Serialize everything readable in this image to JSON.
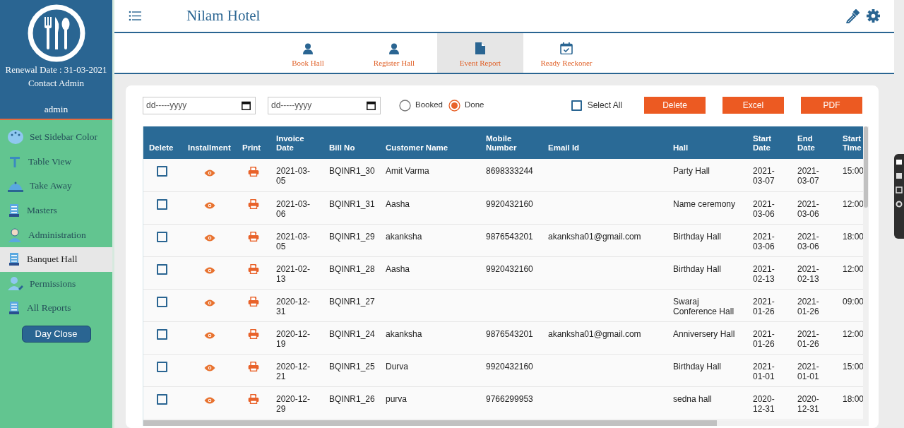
{
  "sidebar": {
    "renewal": "Renewal Date : 31-03-2021",
    "contact": "Contact Admin",
    "user": "admin",
    "items": [
      {
        "label": "Set Sidebar Color",
        "selected": false
      },
      {
        "label": "Table View",
        "selected": false
      },
      {
        "label": "Take Away",
        "selected": false
      },
      {
        "label": "Masters",
        "selected": false
      },
      {
        "label": "Administration",
        "selected": false
      },
      {
        "label": "Banquet Hall",
        "selected": true
      },
      {
        "label": "Permissions",
        "selected": false
      },
      {
        "label": "All Reports",
        "selected": false
      }
    ],
    "day_close": "Day Close"
  },
  "header": {
    "title": "Nilam Hotel"
  },
  "tabs": [
    {
      "label": "Book Hall",
      "selected": false
    },
    {
      "label": "Register Hall",
      "selected": false
    },
    {
      "label": "Event Report",
      "selected": true
    },
    {
      "label": "Ready Reckoner",
      "selected": false
    }
  ],
  "filters": {
    "date_from": {
      "placeholder": "dd-----yyyy"
    },
    "date_to": {
      "placeholder": "dd-----yyyy"
    },
    "status_options": [
      {
        "label": "Booked",
        "selected": false
      },
      {
        "label": "Done",
        "selected": true
      }
    ],
    "select_all": {
      "label": "Select All",
      "checked": false
    },
    "buttons": [
      "Delete",
      "Excel",
      "PDF"
    ]
  },
  "table": {
    "columns": [
      "Delete",
      "Installment",
      "Print",
      "Invoice Date",
      "Bill No",
      "Customer Name",
      "Mobile Number",
      "Email Id",
      "Hall",
      "Start Date",
      "End Date",
      "Start Time"
    ],
    "rows": [
      {
        "checked": false,
        "cells": [
          "",
          "",
          "",
          "2021-03-05",
          "BQINR1_30",
          "Amit Varma",
          "8698333244",
          "",
          "Party Hall",
          "2021-03-07",
          "2021-03-07",
          "15:00"
        ]
      },
      {
        "checked": false,
        "cells": [
          "",
          "",
          "",
          "2021-03-06",
          "BQINR1_31",
          "Aasha",
          "9920432160",
          "",
          "Name ceremony",
          "2021-03-06",
          "2021-03-06",
          "12:00"
        ]
      },
      {
        "checked": false,
        "cells": [
          "",
          "",
          "",
          "2021-03-05",
          "BQINR1_29",
          "akanksha",
          "9876543201",
          "akanksha01@gmail.com",
          "Birthday Hall",
          "2021-03-06",
          "2021-03-06",
          "18:00"
        ]
      },
      {
        "checked": false,
        "cells": [
          "",
          "",
          "",
          "2021-02-13",
          "BQINR1_28",
          "Aasha",
          "9920432160",
          "",
          "Birthday Hall",
          "2021-02-13",
          "2021-02-13",
          "12:00"
        ]
      },
      {
        "checked": false,
        "cells": [
          "",
          "",
          "",
          "2020-12-31",
          "BQINR1_27",
          "",
          "",
          "",
          "Swaraj Conference Hall",
          "2021-01-26",
          "2021-01-26",
          "09:00"
        ]
      },
      {
        "checked": false,
        "cells": [
          "",
          "",
          "",
          "2020-12-19",
          "BQINR1_24",
          "akanksha",
          "9876543201",
          "akanksha01@gmail.com",
          "Anniversery Hall",
          "2021-01-26",
          "2021-01-26",
          "12:00"
        ]
      },
      {
        "checked": false,
        "cells": [
          "",
          "",
          "",
          "2020-12-21",
          "BQINR1_25",
          "Durva",
          "9920432160",
          "",
          "Birthday Hall",
          "2021-01-01",
          "2021-01-01",
          "15:00"
        ]
      },
      {
        "checked": false,
        "cells": [
          "",
          "",
          "",
          "2020-12-29",
          "BQINR1_26",
          "purva",
          "9766299953",
          "",
          "sedna hall",
          "2020-12-31",
          "2020-12-31",
          "18:00"
        ]
      }
    ]
  }
}
